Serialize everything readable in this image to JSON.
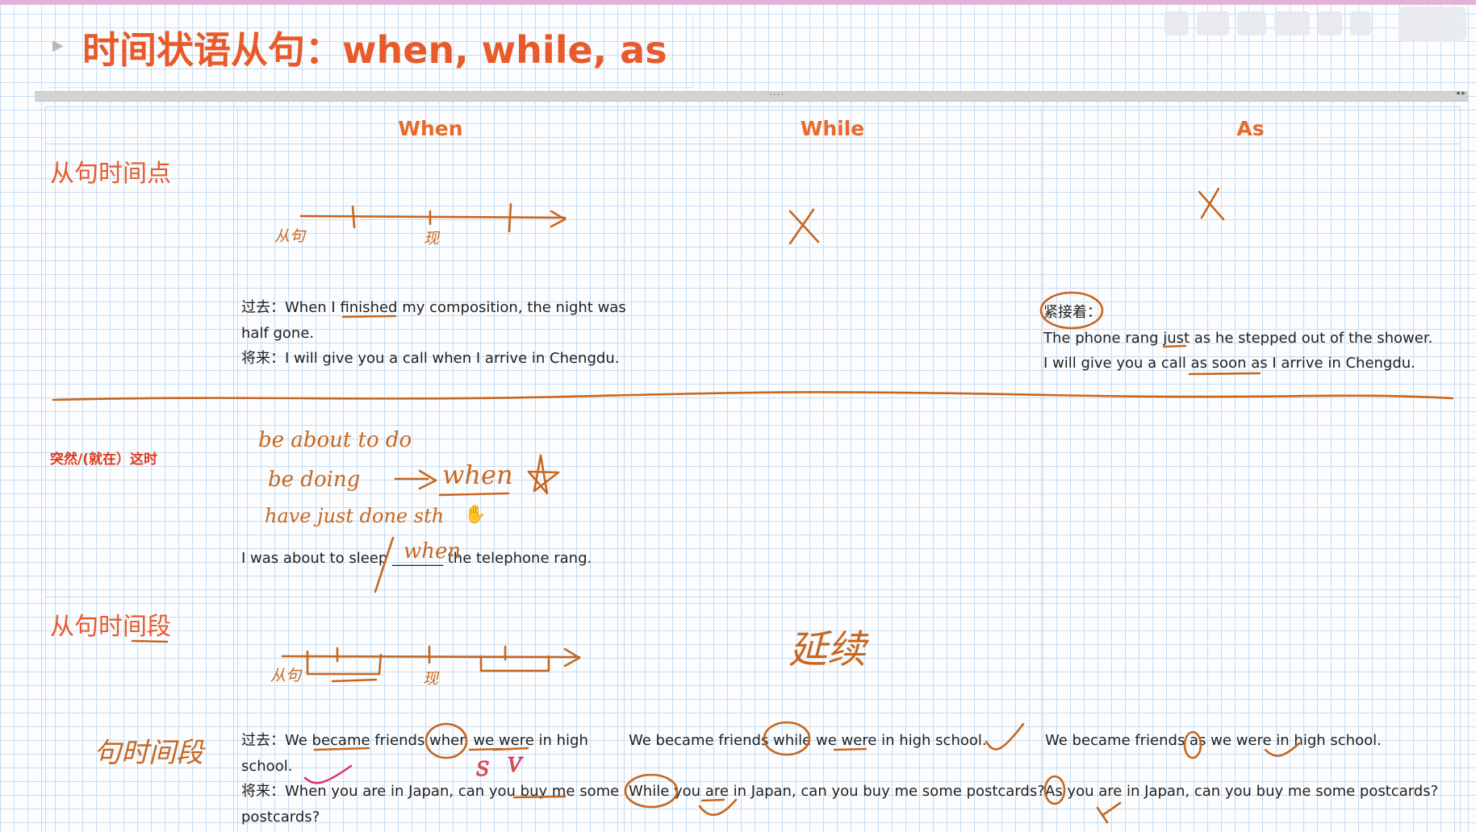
{
  "title": "时间状语从句：when, while, as",
  "columns": {
    "when": "When",
    "while": "While",
    "as": "As"
  },
  "rows": {
    "point": "从句时间点",
    "sudden": "突然/(就在）这时",
    "period": "从句时间段"
  },
  "when_point": {
    "line1": "过去：When I finished my composition, the night was",
    "line2": "half gone.",
    "line3": "将来：I will give you a call when I arrive in Chengdu."
  },
  "as_point": {
    "tag": "紧接着：",
    "line1": "The phone rang just as he stepped out of the shower.",
    "line2": "I will give you a call as soon as I arrive in Chengdu."
  },
  "when_sudden": {
    "sentence": "I was about to sleep _______ the telephone rang."
  },
  "when_period": {
    "line1": "过去：We became friends when we were in high",
    "line2": "school.",
    "line3": "将来：When you are in Japan, can you buy me some",
    "line4": "postcards?"
  },
  "while_period": {
    "line1": "We became friends while we were in high school.",
    "line2": "While you are in Japan, can you buy me some postcards?"
  },
  "as_period": {
    "line1": "We became friends as we were in high school.",
    "line2": "As you are in Japan, can you buy me some postcards?"
  },
  "handwriting": {
    "point_label_left": "从句",
    "point_label_now": "现",
    "sudden_line1": "be about to do",
    "sudden_line2": "be doing",
    "sudden_arrow_word": "when",
    "sudden_line3": "have just done sth",
    "sudden_blank_word": "when",
    "period_label_left": "从句",
    "period_label_now": "现",
    "period_label_row": "句时间段",
    "period_while_note": "延续"
  },
  "colors": {
    "accent": "#e85a2a",
    "ink": "#c8661e",
    "grid": "#c9dcef",
    "pink_ink": "#e0356a"
  }
}
